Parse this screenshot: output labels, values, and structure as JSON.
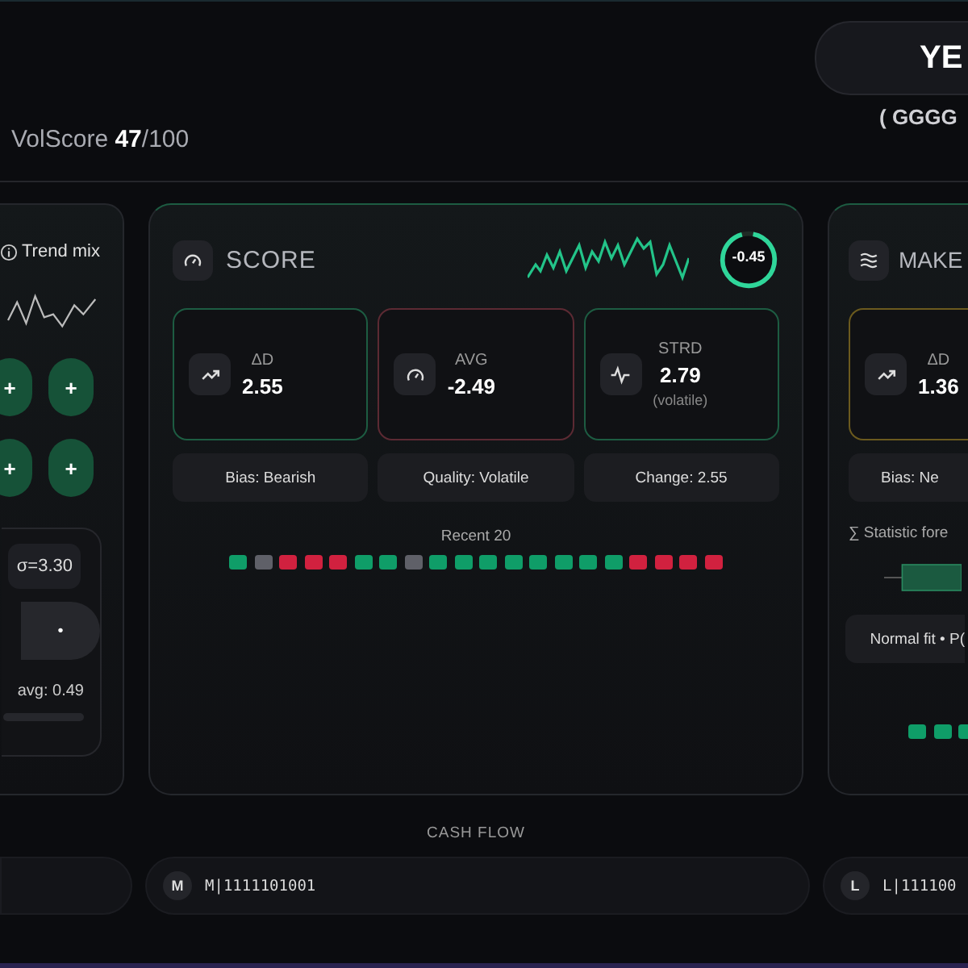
{
  "header": {
    "score_label": "VolScore",
    "score": "47",
    "score_max": "/100",
    "badge": "YE",
    "code": "( GGGG"
  },
  "left_panel": {
    "title": "Trend mix",
    "buttons": [
      "+",
      "+",
      "+",
      "+"
    ],
    "sigma": "σ=3.30",
    "dot": "•",
    "avg": "avg: 0.49"
  },
  "score_card": {
    "title": "SCORE",
    "ring": {
      "value": "-0.45",
      "level": 0.93
    },
    "stats": [
      {
        "label": "ΔD",
        "value": "2.55",
        "kind": "trend",
        "color": "#1d5c42"
      },
      {
        "label": "AVG",
        "value": "-2.49",
        "kind": "gauge",
        "color": "#5c2a33"
      },
      {
        "label": "STRD",
        "value": "2.79",
        "note": "(volatile)",
        "kind": "pulse",
        "color": "#1d5c42"
      }
    ],
    "chips": [
      "Bias: Bearish",
      "Quality: Volatile",
      "Change: 2.55"
    ],
    "recent_label": "Recent 20",
    "recent": [
      {
        "color": "#0f9d68"
      },
      {
        "color": "#5f6068"
      },
      {
        "color": "#d1213f"
      },
      {
        "color": "#d1213f"
      },
      {
        "color": "#d1213f"
      },
      {
        "color": "#0f9d68"
      },
      {
        "color": "#0f9d68"
      },
      {
        "color": "#5f6068"
      },
      {
        "color": "#0f9d68"
      },
      {
        "color": "#0f9d68"
      },
      {
        "color": "#0f9d68"
      },
      {
        "color": "#0f9d68"
      },
      {
        "color": "#0f9d68"
      },
      {
        "color": "#0f9d68"
      },
      {
        "color": "#0f9d68"
      },
      {
        "color": "#0f9d68"
      },
      {
        "color": "#d1213f"
      },
      {
        "color": "#d1213f"
      },
      {
        "color": "#d1213f"
      },
      {
        "color": "#d1213f"
      }
    ]
  },
  "make_card": {
    "title": "MAKE",
    "stats": [
      {
        "label": "ΔD",
        "value": "1.36",
        "kind": "trend",
        "color": "#6b5a1e"
      }
    ],
    "chips": [
      "Bias: Ne"
    ],
    "forecast_label": "∑ Statistic fore",
    "fit": "Normal fit • P(",
    "recent": [
      {
        "color": "#0f9d68"
      },
      {
        "color": "#0f9d68"
      },
      {
        "color": "#0f9d68"
      }
    ]
  },
  "cash_flow": {
    "title": "CASH FLOW",
    "rows": [
      {
        "badge": "M",
        "text": "M|1111101001"
      },
      {
        "badge": "L",
        "text": "L|111100"
      }
    ]
  }
}
